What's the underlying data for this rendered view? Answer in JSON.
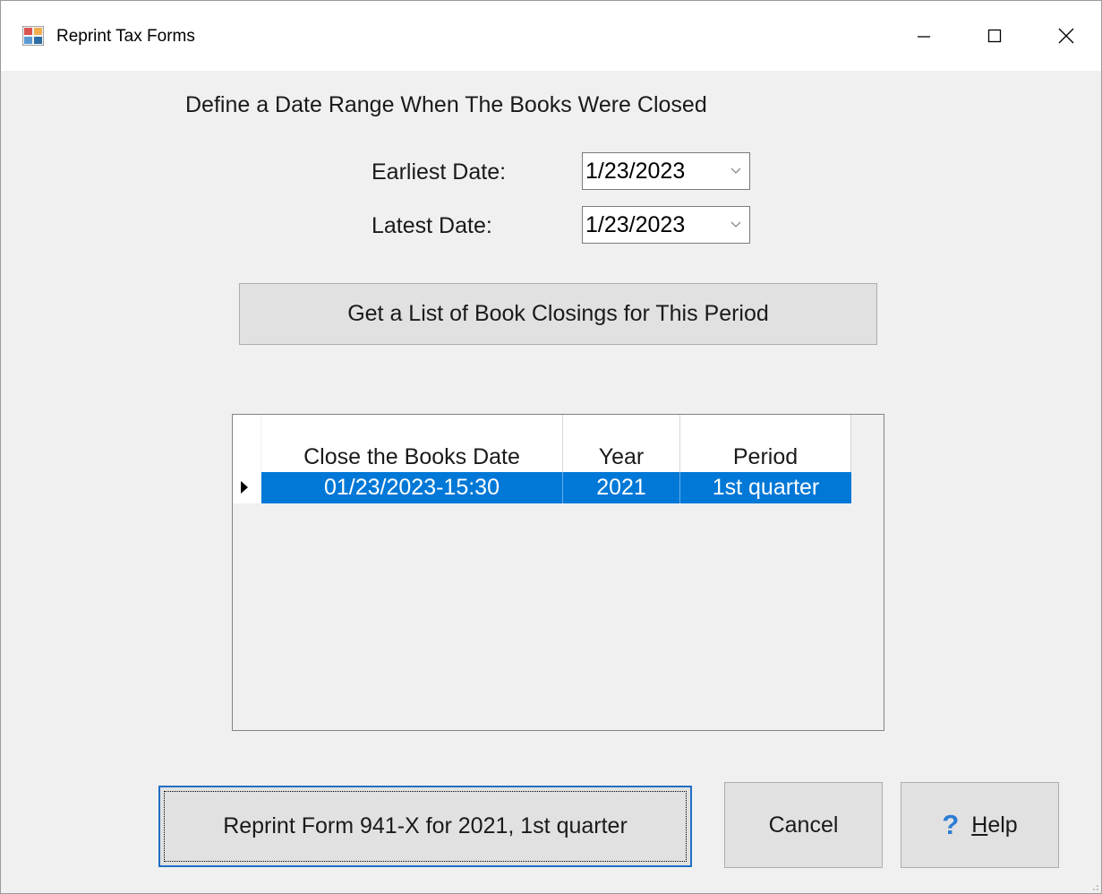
{
  "window": {
    "title": "Reprint Tax Forms",
    "icon": "app-form-icon",
    "controls": [
      "minimize-icon",
      "maximize-icon",
      "close-icon"
    ]
  },
  "form": {
    "heading": "Define a Date Range When The Books Were Closed",
    "earliest_label": "Earliest Date:",
    "earliest_value": "1/23/2023",
    "latest_label": "Latest Date:",
    "latest_value": "1/23/2023",
    "get_list_button": "Get a List of Book Closings for This Period"
  },
  "grid": {
    "columns": [
      "Close the Books Date",
      "Year",
      "Period"
    ],
    "rows": [
      {
        "date": "01/23/2023-15:30",
        "year": "2021",
        "period": "1st quarter",
        "selected": true
      }
    ]
  },
  "buttons": {
    "reprint": "Reprint Form 941-X for 2021, 1st quarter",
    "cancel": "Cancel",
    "help_prefix": "H",
    "help_rest": "elp"
  },
  "colors": {
    "selection": "#0078d7",
    "help_icon": "#2b7cd3",
    "focus_border": "#1f6fc5"
  }
}
